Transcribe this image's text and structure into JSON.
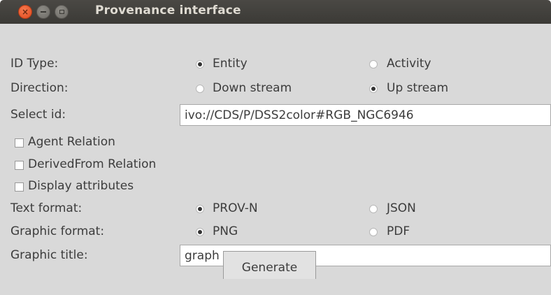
{
  "window": {
    "title": "Provenance interface"
  },
  "form": {
    "id_type": {
      "label": "ID Type:",
      "options": [
        "Entity",
        "Activity"
      ],
      "selected": "Entity"
    },
    "direction": {
      "label": "Direction:",
      "options": [
        "Down stream",
        "Up stream"
      ],
      "selected": "Up stream"
    },
    "select_id": {
      "label": "Select id:",
      "value": "ivo://CDS/P/DSS2color#RGB_NGC6946"
    },
    "checkboxes": [
      {
        "label": "Agent Relation",
        "checked": false
      },
      {
        "label": "DerivedFrom Relation",
        "checked": false
      },
      {
        "label": "Display attributes",
        "checked": false
      }
    ],
    "text_format": {
      "label": "Text format:",
      "options": [
        "PROV-N",
        "JSON"
      ],
      "selected": "PROV-N"
    },
    "graphic_format": {
      "label": "Graphic format:",
      "options": [
        "PNG",
        "PDF"
      ],
      "selected": "PNG"
    },
    "graphic_title": {
      "label": "Graphic title:",
      "value": "graph"
    },
    "generate_label": "Generate"
  }
}
